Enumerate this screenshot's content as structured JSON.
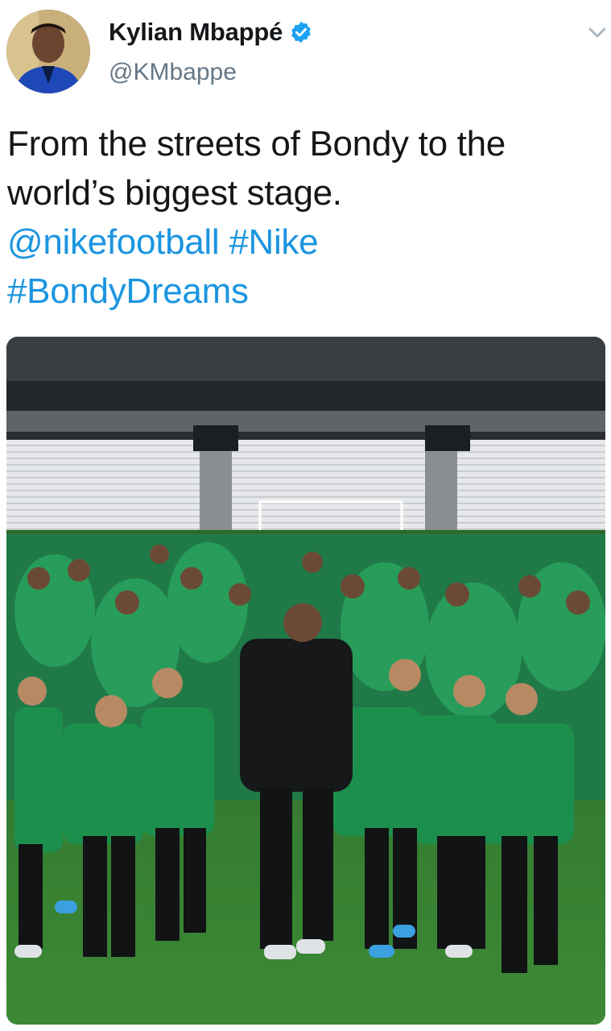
{
  "author": {
    "name": "Kylian Mbappé",
    "handle": "@KMbappe",
    "avatar_icon": "profile-avatar",
    "verified_icon": "verified-badge-icon"
  },
  "menu_icon": "chevron-down-icon",
  "tweet": {
    "line1": "From the streets of Bondy to the",
    "line2": "world’s biggest stage.",
    "mention": "@nikefootball",
    "hashtag1": "#Nike",
    "hashtag2": "#BondyDreams"
  },
  "media": {
    "type": "photo",
    "description_icon": "stadium-photo",
    "colors": {
      "grass": "#2f7a2e",
      "jersey": "#1f8a4e",
      "seats": "#e8eaec",
      "roof": "#3a3d40"
    }
  },
  "colors": {
    "link": "#1b95e0",
    "secondary_text": "#657786",
    "verified": "#1da1f2"
  }
}
